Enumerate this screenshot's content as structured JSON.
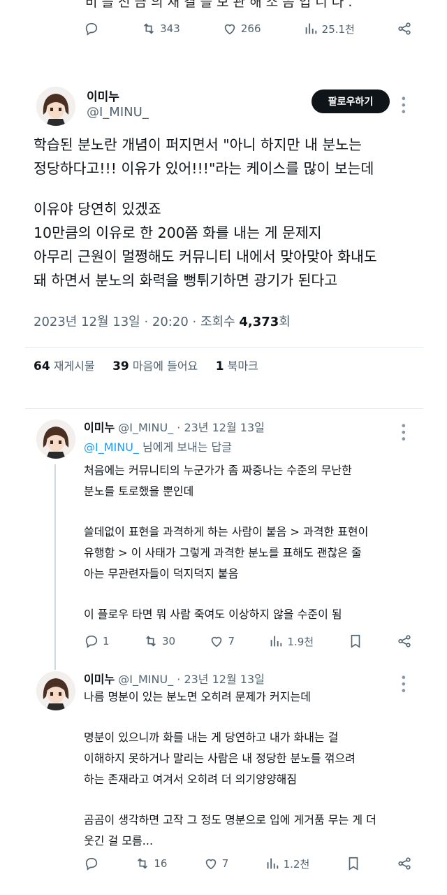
{
  "top_tweet": {
    "cut_text": "비 를 전 금 의 재 결 을 보 관 해 소 음 입 니 다 .",
    "replies": "",
    "retweets": "343",
    "likes": "266",
    "views": "25.1천"
  },
  "main_tweet": {
    "name": "이미누",
    "handle": "@I_MINU_",
    "follow_label": "팔로우하기",
    "lines": [
      "학습된 분노란 개념이 퍼지면서 \"아니 하지만 내 분노는",
      "정당하다고!!! 이유가 있어!!!\"라는 케이스를 많이 보는데",
      "",
      "이유야 당연히 있겠죠",
      "10만큼의 이유로 한 200쯤 화를 내는 게 문제지",
      "아무리 근원이 멀쩡해도 커뮤니티 내에서 맞아맞아 화내도",
      "돼 하면서 분노의 화력을 뻥튀기하면 광기가 된다고"
    ],
    "date": "2023년 12월 13일 · 20:20 · 조회수 ",
    "views": "4,373",
    "views_suffix": "회",
    "retweets": "64",
    "retweets_label": "재게시물",
    "likes": "39",
    "likes_label": "마음에 들어요",
    "bookmarks": "1",
    "bookmarks_label": "북마크"
  },
  "reply1": {
    "name": "이미누",
    "handle_date": "@I_MINU_ · 23년 12월 13일",
    "reply_to": "@I_MINU_",
    "reply_to_suffix": " 님에게 보내는 답글",
    "lines": [
      "처음에는 커뮤니티의 누군가가 좀 짜증나는 수준의 무난한",
      "분노를 토로했을 뿐인데",
      "",
      "쓸데없이 표현을 과격하게 하는 사람이 붙음 > 과격한 표현이",
      "유행함 > 이 사태가 그렇게 과격한 분노를 표해도 괜찮은 줄",
      "아는 무관련자들이 덕지덕지 붙음",
      "",
      "이 플로우 타면 뭐 사람 죽여도 이상하지 않을 수준이 됨"
    ],
    "replies": "1",
    "retweets": "30",
    "likes": "7",
    "views": "1.9천"
  },
  "reply2": {
    "name": "이미누",
    "handle_date": "@I_MINU_ · 23년 12월 13일",
    "lines": [
      "나름 명분이 있는 분노면 오히려 문제가 커지는데",
      "",
      "명분이 있으니까 화를 내는 게 당연하고 내가 화내는 걸",
      "이해하지 못하거나 말리는 사람은 내 정당한 분노를 꺾으려",
      "하는 존재라고 여겨서 오히려 더 의기양양해짐",
      "",
      "곰곰이 생각하면 고작 그 정도 명분으로 입에 게거품 무는 게 더",
      "웃긴 걸 모름..."
    ],
    "replies": "",
    "retweets": "16",
    "likes": "7",
    "views": "1.2천"
  }
}
